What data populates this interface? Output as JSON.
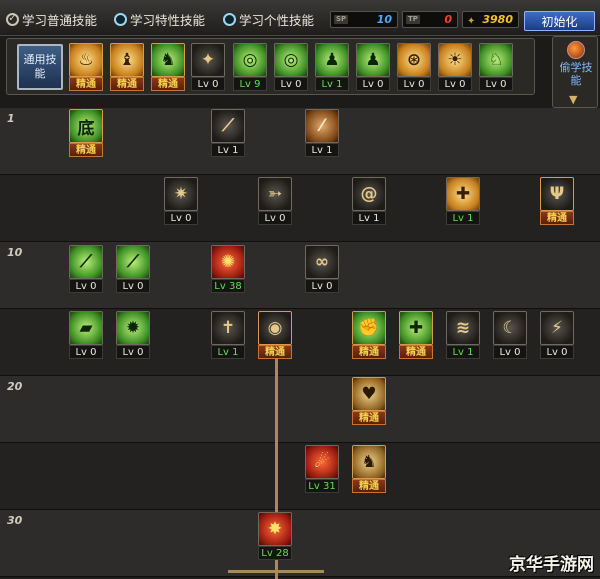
{
  "tabs": [
    {
      "label": "学习普通技能",
      "selected": true
    },
    {
      "label": "学习特性技能",
      "selected": false
    },
    {
      "label": "学习个性技能",
      "selected": false
    }
  ],
  "resources": {
    "blue": {
      "tag": "SP",
      "value": "10",
      "color": "#49a8ff"
    },
    "red": {
      "tag": "TP",
      "value": "0",
      "color": "#ff3c2a"
    },
    "gold": {
      "value": "3980",
      "color": "#f7c21b"
    }
  },
  "init_button": "初始化",
  "general_label": "通用技能",
  "side_label": "偷学技能",
  "watermark": "京华手游网",
  "row_numbers": [
    "1",
    "10",
    "20",
    "30"
  ],
  "general_skills": [
    {
      "icon": "rest-icon",
      "label": "精通",
      "style": "master",
      "bg": "yellow",
      "glyph": "♨"
    },
    {
      "icon": "crouch-icon",
      "label": "精通",
      "style": "master",
      "bg": "yellow",
      "glyph": "♝"
    },
    {
      "icon": "run-icon",
      "label": "精通",
      "style": "master",
      "bg": "green",
      "glyph": "♞"
    },
    {
      "icon": "wings-icon",
      "label": "Lv 0",
      "style": "normal",
      "bg": "dark",
      "glyph": "✦"
    },
    {
      "icon": "target-icon",
      "label": "Lv 9",
      "style": "green",
      "bg": "green",
      "glyph": "◎"
    },
    {
      "icon": "target-icon",
      "label": "Lv 0",
      "style": "normal",
      "bg": "green",
      "glyph": "◎"
    },
    {
      "icon": "figure-icon",
      "label": "Lv 1",
      "style": "green",
      "bg": "green",
      "glyph": "♟"
    },
    {
      "icon": "figure-icon",
      "label": "Lv 0",
      "style": "normal",
      "bg": "green",
      "glyph": "♟"
    },
    {
      "icon": "spiral-icon",
      "label": "Lv 0",
      "style": "normal",
      "bg": "yellow",
      "glyph": "⊛"
    },
    {
      "icon": "flex-icon",
      "label": "Lv 0",
      "style": "normal",
      "bg": "yellow",
      "glyph": "☀"
    },
    {
      "icon": "kick-icon",
      "label": "Lv 0",
      "style": "normal",
      "bg": "green",
      "glyph": "♘"
    }
  ],
  "skills": [
    {
      "icon": "basic-slash-icon",
      "label": "精通",
      "style": "master",
      "bg": "green",
      "glyph": "底"
    },
    {
      "icon": "claw-icon",
      "label": "Lv 1",
      "style": "normal",
      "bg": "dark",
      "glyph": "⟋"
    },
    {
      "icon": "slash-icon",
      "label": "Lv 1",
      "style": "normal",
      "bg": "brown",
      "glyph": "⁄"
    },
    {
      "icon": "burst-icon",
      "label": "Lv 0",
      "style": "normal",
      "bg": "dark",
      "glyph": "✷"
    },
    {
      "icon": "arrow-icon",
      "label": "Lv 0",
      "style": "normal",
      "bg": "dark",
      "glyph": "➳"
    },
    {
      "icon": "whirl-icon",
      "label": "Lv 1",
      "style": "normal",
      "bg": "dark",
      "glyph": "@"
    },
    {
      "icon": "shield-icon",
      "label": "Lv 1",
      "style": "green",
      "bg": "yellow",
      "glyph": "✚"
    },
    {
      "icon": "wing-crest-icon",
      "label": "精通",
      "style": "master",
      "bg": "dark",
      "glyph": "Ψ"
    },
    {
      "icon": "sword-icon",
      "label": "Lv 0",
      "style": "normal",
      "bg": "green",
      "glyph": "⟋"
    },
    {
      "icon": "blade-icon",
      "label": "Lv 0",
      "style": "normal",
      "bg": "green",
      "glyph": "⟋"
    },
    {
      "icon": "fire-icon",
      "label": "Lv 38",
      "style": "green",
      "bg": "red",
      "glyph": "✺"
    },
    {
      "icon": "swirl-icon",
      "label": "Lv 0",
      "style": "normal",
      "bg": "dark",
      "glyph": "∞"
    },
    {
      "icon": "scroll-icon",
      "label": "Lv 0",
      "style": "normal",
      "bg": "green",
      "glyph": "▰"
    },
    {
      "icon": "splash-icon",
      "label": "Lv 0",
      "style": "normal",
      "bg": "green",
      "glyph": "✹"
    },
    {
      "icon": "cross-blade-icon",
      "label": "Lv 1",
      "style": "green",
      "bg": "dark",
      "glyph": "✝"
    },
    {
      "icon": "eye-icon",
      "label": "精通",
      "style": "master",
      "bg": "dark",
      "glyph": "◉"
    },
    {
      "icon": "muscle-icon",
      "label": "精通",
      "style": "master",
      "bg": "green",
      "glyph": "✊"
    },
    {
      "icon": "heal-cross-icon",
      "label": "精通",
      "style": "master",
      "bg": "green",
      "glyph": "✚"
    },
    {
      "icon": "gust-icon",
      "label": "Lv 1",
      "style": "green",
      "bg": "dark",
      "glyph": "≋"
    },
    {
      "icon": "crescent-icon",
      "label": "Lv 0",
      "style": "normal",
      "bg": "dark",
      "glyph": "☾"
    },
    {
      "icon": "flame-slash-icon",
      "label": "Lv 0",
      "style": "normal",
      "bg": "dark",
      "glyph": "⚡"
    },
    {
      "icon": "heart-shield-icon",
      "label": "精通",
      "style": "master",
      "bg": "gold",
      "glyph": "♥"
    },
    {
      "icon": "meteor-icon",
      "label": "Lv 31",
      "style": "green",
      "bg": "red",
      "glyph": "☄"
    },
    {
      "icon": "warrior-icon",
      "label": "精通",
      "style": "master",
      "bg": "gold",
      "glyph": "♞"
    },
    {
      "icon": "explosion-icon",
      "label": "Lv 28",
      "style": "green",
      "bg": "red",
      "glyph": "✸"
    }
  ]
}
